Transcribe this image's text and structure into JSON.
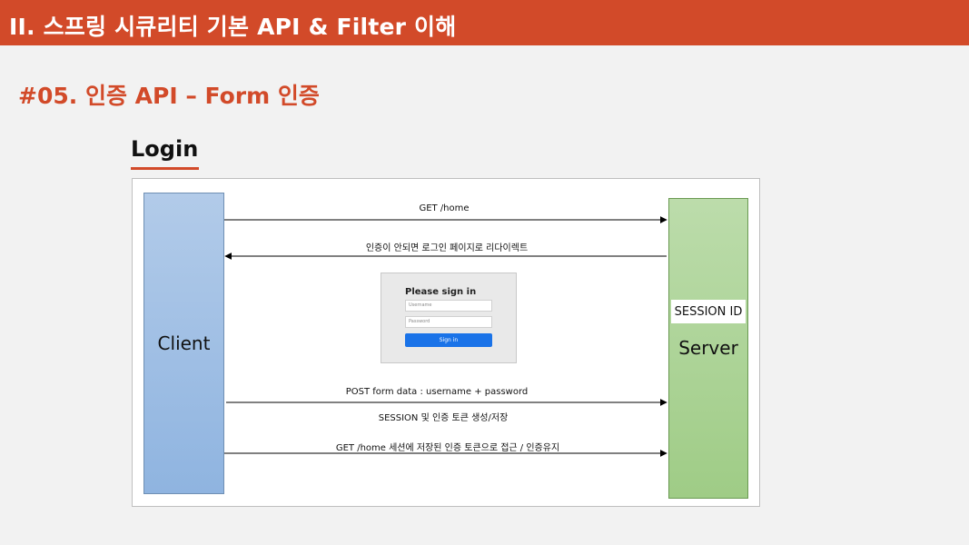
{
  "header": {
    "title": "II. 스프링 시큐리티 기본 API & Filter 이해"
  },
  "section": {
    "title": "#05. 인증 API – Form 인증"
  },
  "diagram": {
    "title": "Login",
    "client_label": "Client",
    "server_label": "Server",
    "session_badge": "SESSION ID",
    "messages": [
      {
        "text": "GET /home",
        "direction": "client-to-server"
      },
      {
        "text": "인증이 안되면 로그인 페이지로 리다이렉트",
        "direction": "server-to-client"
      },
      {
        "text": "POST  form data : username + password",
        "direction": "client-to-server"
      },
      {
        "text": "SESSION 및 인증 토큰 생성/저장",
        "direction": "none"
      },
      {
        "text": "GET /home     세션에 저장된 인증 토큰으로 접근 / 인증유지",
        "direction": "client-to-server"
      }
    ],
    "signin_form": {
      "heading": "Please sign in",
      "username_placeholder": "Username",
      "password_placeholder": "Password",
      "button_label": "Sign in",
      "button_color": "#1a73e8"
    }
  },
  "colors": {
    "accent": "#d24a29",
    "client_fill": "#9dbde5",
    "server_fill": "#a9d18e"
  }
}
